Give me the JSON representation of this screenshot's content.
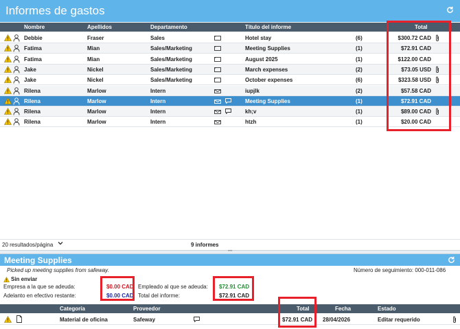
{
  "app": {
    "title": "Informes de gastos"
  },
  "columns": {
    "first_name": "Nombre",
    "last_name": "Apellidos",
    "department": "Departamento",
    "report_title": "Título del informe",
    "total": "Total"
  },
  "rows": [
    {
      "first": "Debbie",
      "last": "Fraser",
      "dept": "Sales",
      "envelope": "closed",
      "chat": false,
      "title": "Hotel stay",
      "count": "(6)",
      "total": "$300.72 CAD",
      "attachment": true,
      "selected": false
    },
    {
      "first": "Fatima",
      "last": "Mian",
      "dept": "Sales/Marketing",
      "envelope": "closed",
      "chat": false,
      "title": "Meeting Supplies",
      "count": "(1)",
      "total": "$72.91 CAD",
      "attachment": false,
      "selected": false
    },
    {
      "first": "Fatima",
      "last": "Mian",
      "dept": "Sales/Marketing",
      "envelope": "closed",
      "chat": false,
      "title": "August 2025",
      "count": "(1)",
      "total": "$122.00 CAD",
      "attachment": false,
      "selected": false
    },
    {
      "first": "Jake",
      "last": "Nickel",
      "dept": "Sales/Marketing",
      "envelope": "closed",
      "chat": false,
      "title": "March expenses",
      "count": "(2)",
      "total": "$73.05 USD",
      "attachment": true,
      "selected": false
    },
    {
      "first": "Jake",
      "last": "Nickel",
      "dept": "Sales/Marketing",
      "envelope": "closed",
      "chat": false,
      "title": "October expenses",
      "count": "(6)",
      "total": "$323.58 USD",
      "attachment": true,
      "selected": false
    },
    {
      "first": "Rilena",
      "last": "Marlow",
      "dept": "Intern",
      "envelope": "open",
      "chat": false,
      "title": "iupjlk",
      "count": "(2)",
      "total": "$57.58 CAD",
      "attachment": false,
      "selected": false
    },
    {
      "first": "Rilena",
      "last": "Marlow",
      "dept": "Intern",
      "envelope": "open",
      "chat": true,
      "title": "Meeting Supplies",
      "count": "(1)",
      "total": "$72.91 CAD",
      "attachment": false,
      "selected": true
    },
    {
      "first": "Rilena",
      "last": "Marlow",
      "dept": "Intern",
      "envelope": "open",
      "chat": true,
      "title": "kh;v",
      "count": "(1)",
      "total": "$89.00 CAD",
      "attachment": true,
      "selected": false
    },
    {
      "first": "Rilena",
      "last": "Marlow",
      "dept": "Intern",
      "envelope": "open",
      "chat": false,
      "title": "htzh",
      "count": "(1)",
      "total": "$20.00 CAD",
      "attachment": false,
      "selected": false
    }
  ],
  "footer": {
    "results_per_page": "20 resultados/página",
    "count_label": "9 informes"
  },
  "detail": {
    "title": "Meeting Supplies",
    "description": "Picked up meeting supplies from safeway.",
    "tracking": "Número de seguimiento: 000-011-086",
    "status": "Sin enviar",
    "company_owed_label": "Empresa a la que se adeuda:",
    "company_owed_value": "$0.00 CAD",
    "advance_label": "Adelanto en efectivo restante:",
    "advance_value": "$0.00 CAD",
    "employee_owed_label": "Empleado al que se adeuda:",
    "employee_owed_value": "$72.91 CAD",
    "report_total_label": "Total del informe:",
    "report_total_value": "$72.91 CAD",
    "columns": {
      "category": "Categoría",
      "vendor": "Proveedor",
      "total": "Total",
      "date": "Fecha",
      "status": "Estado"
    },
    "items": [
      {
        "category": "Material de oficina",
        "vendor": "Safeway",
        "total": "$72.91 CAD",
        "date": "28/04/2026",
        "status": "Editar requerido"
      }
    ]
  },
  "colors": {
    "header_blue": "#5fb4ea",
    "column_header": "#4a5b6b",
    "selected_row": "#3d8fce",
    "owed_red": "#d2141e",
    "advance_blue": "#1e28a0",
    "employee_green": "#238c32",
    "highlight_red": "#e8202a"
  },
  "icons": [
    "warning-icon",
    "person-icon",
    "envelope-icon",
    "open-envelope-icon",
    "chat-icon",
    "paperclip-icon",
    "refresh-icon",
    "chevron-down-icon",
    "document-icon"
  ]
}
